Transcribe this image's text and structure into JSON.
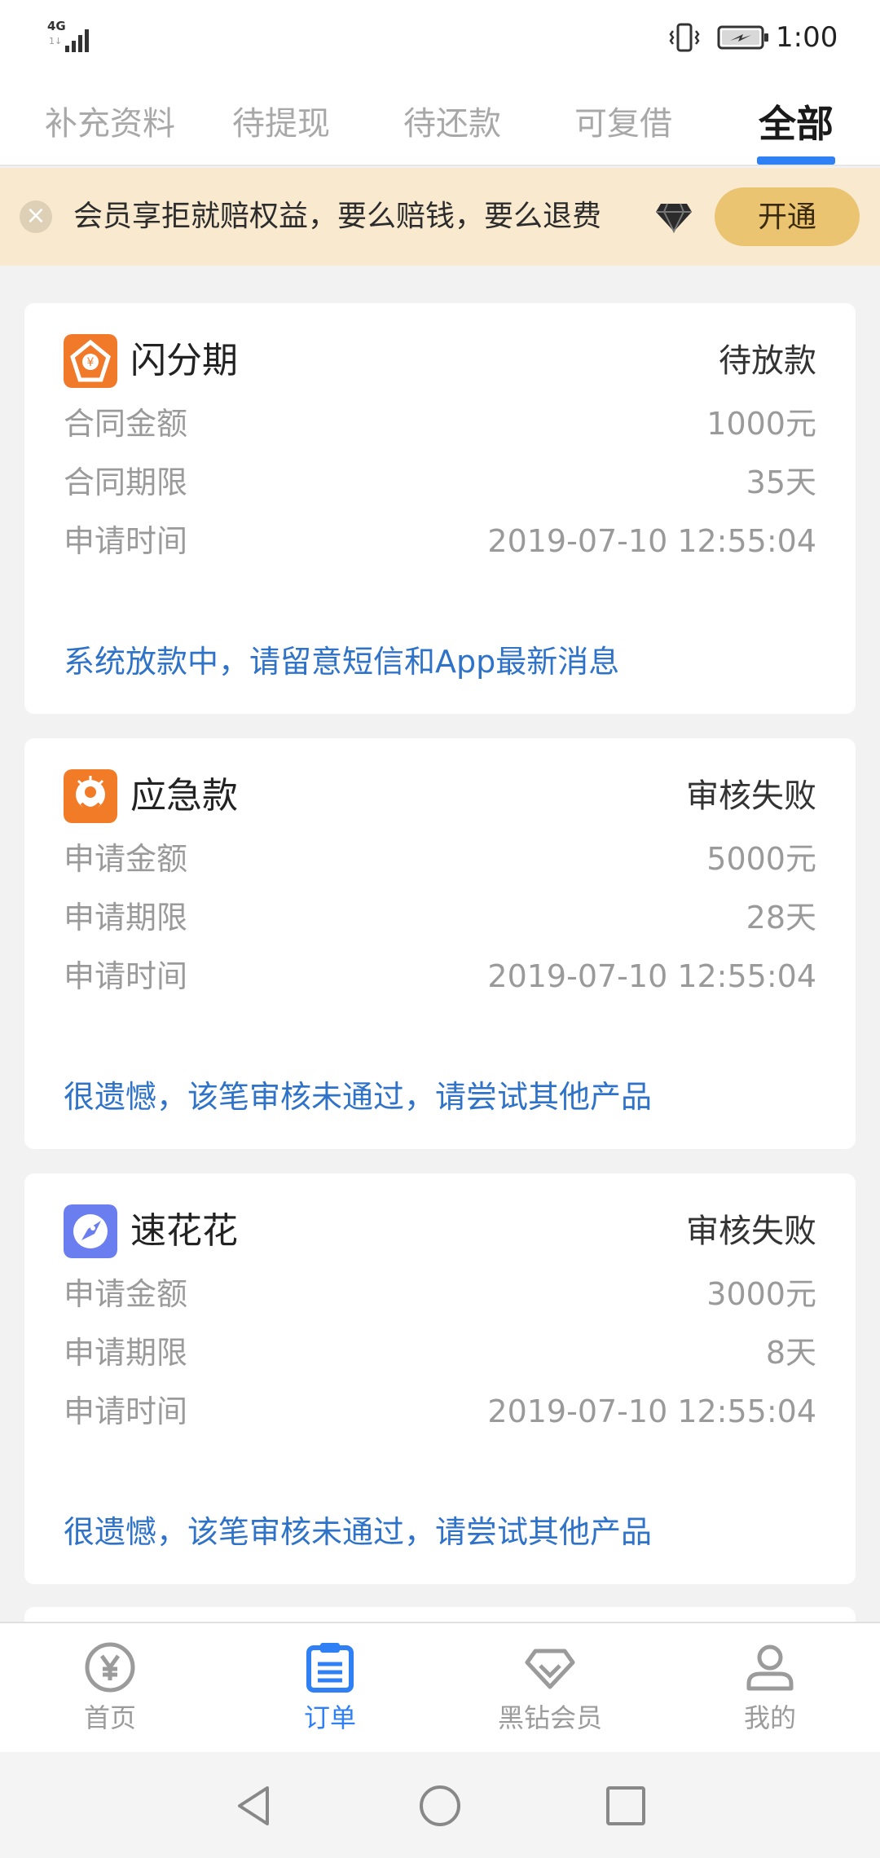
{
  "status_bar": {
    "network": "4G",
    "network_sub": "1↓",
    "time": "1:00",
    "icons": [
      "signal-icon",
      "vibrate-icon",
      "battery-charging-icon"
    ]
  },
  "tabs": [
    {
      "label": "补充资料",
      "active": false
    },
    {
      "label": "待提现",
      "active": false
    },
    {
      "label": "待还款",
      "active": false
    },
    {
      "label": "可复借",
      "active": false
    },
    {
      "label": "全部",
      "active": true
    }
  ],
  "banner": {
    "text": "会员享拒就赔权益，要么赔钱，要么退费",
    "button": "开通",
    "icons": [
      "close-icon",
      "diamond-icon"
    ]
  },
  "orders": [
    {
      "name": "闪分期",
      "status": "待放款",
      "logo_color": "#f07a2a",
      "rows": [
        {
          "label": "合同金额",
          "value": "1000元"
        },
        {
          "label": "合同期限",
          "value": "35天"
        },
        {
          "label": "申请时间",
          "value": "2019-07-10 12:55:04"
        }
      ],
      "note": "系统放款中，请留意短信和App最新消息"
    },
    {
      "name": "应急款",
      "status": "审核失败",
      "logo_color": "#f27b28",
      "rows": [
        {
          "label": "申请金额",
          "value": "5000元"
        },
        {
          "label": "申请期限",
          "value": "28天"
        },
        {
          "label": "申请时间",
          "value": "2019-07-10 12:55:04"
        }
      ],
      "note": "很遗憾，该笔审核未通过，请尝试其他产品"
    },
    {
      "name": "速花花",
      "status": "审核失败",
      "logo_color": "#6b7ef0",
      "rows": [
        {
          "label": "申请金额",
          "value": "3000元"
        },
        {
          "label": "申请期限",
          "value": "8天"
        },
        {
          "label": "申请时间",
          "value": "2019-07-10 12:55:04"
        }
      ],
      "note": "很遗憾，该笔审核未通过，请尝试其他产品"
    }
  ],
  "bottom_nav": [
    {
      "label": "首页",
      "icon": "yen-coin-icon",
      "active": false
    },
    {
      "label": "订单",
      "icon": "clipboard-icon",
      "active": true
    },
    {
      "label": "黑钻会员",
      "icon": "diamond-icon",
      "active": false
    },
    {
      "label": "我的",
      "icon": "person-icon",
      "active": false
    }
  ],
  "system_nav": [
    "back-icon",
    "home-icon",
    "recents-icon"
  ],
  "colors": {
    "accent": "#2f7ff5",
    "note_blue": "#2f73c9",
    "banner_bg": "#f8e9cf",
    "banner_button": "#ebc472"
  }
}
